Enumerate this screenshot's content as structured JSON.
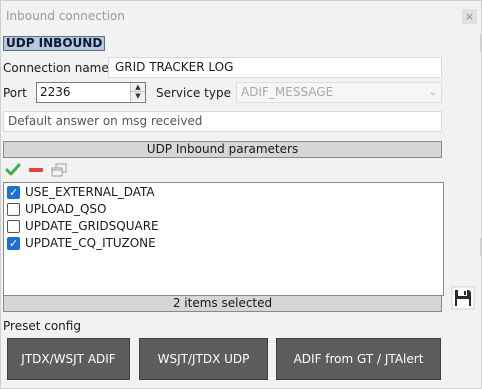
{
  "window": {
    "title": "Inbound connection",
    "close_glyph": "×"
  },
  "section": {
    "header": "UDP INBOUND"
  },
  "form": {
    "connection_name_label": "Connection name",
    "connection_name_value": "GRID TRACKER LOG",
    "port_label": "Port",
    "port_value": "2236",
    "service_type_label": "Service type",
    "service_type_value": "ADIF_MESSAGE",
    "default_answer_placeholder": "Default answer on msg received"
  },
  "params": {
    "header": "UDP Inbound parameters",
    "toolbar": {
      "add_icon": "checkmark-add-icon",
      "remove_icon": "minus-remove-icon",
      "window_icon": "window-icon"
    },
    "items": [
      {
        "label": "USE_EXTERNAL_DATA",
        "checked": true
      },
      {
        "label": "UPLOAD_QSO",
        "checked": false
      },
      {
        "label": "UPDATE_GRIDSQUARE",
        "checked": false
      },
      {
        "label": "UPDATE_CQ_ITUZONE",
        "checked": true
      }
    ],
    "status": "2 items selected",
    "save_icon": "floppy-disk-icon"
  },
  "preset": {
    "label": "Preset config",
    "buttons": [
      "JTDX/WSJT ADIF",
      "WSJT/JTDX UDP",
      "ADIF from GT / JTAlert"
    ]
  },
  "colors": {
    "header_bg": "#b9c7dc",
    "checkbox_checked": "#1d6fd2",
    "button_bg": "#5d5d5d",
    "add_icon": "#3cb043",
    "remove_icon": "#e0413a"
  }
}
